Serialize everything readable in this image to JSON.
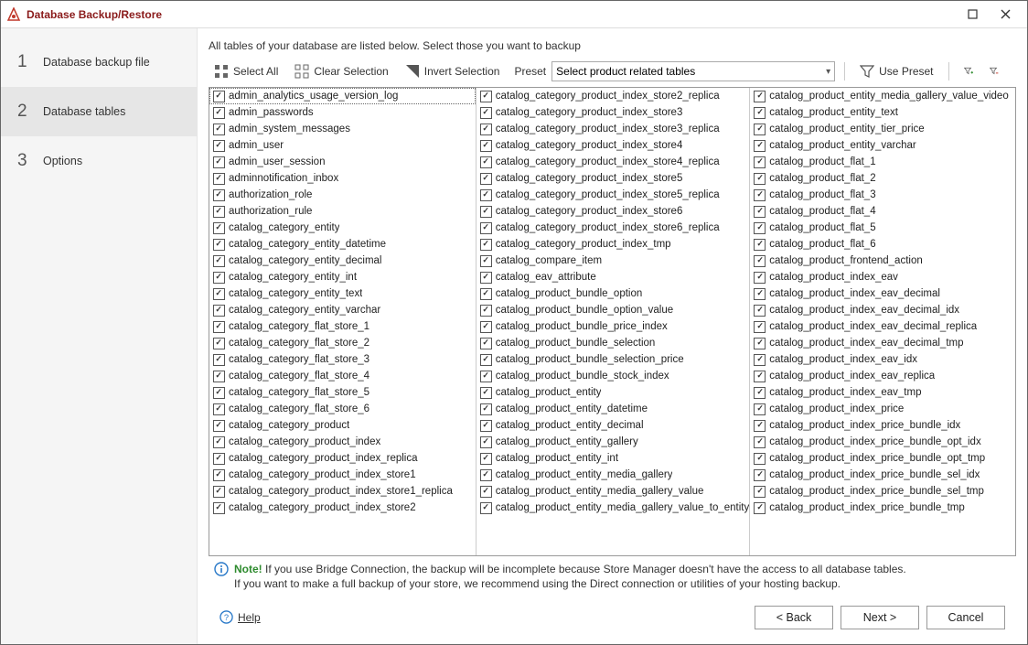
{
  "window": {
    "title": "Database Backup/Restore",
    "maximize_icon": "maximize-icon",
    "close_icon": "close-icon"
  },
  "sidebar": {
    "steps": [
      {
        "num": "1",
        "label": "Database backup file"
      },
      {
        "num": "2",
        "label": "Database tables"
      },
      {
        "num": "3",
        "label": "Options"
      }
    ],
    "active_index": 1
  },
  "main": {
    "instructions": "All tables of your database are listed below. Select those you want to backup",
    "toolbar": {
      "select_all": "Select All",
      "clear_selection": "Clear Selection",
      "invert_selection": "Invert Selection",
      "preset_label": "Preset",
      "preset_value": "Select product related tables",
      "use_preset": "Use Preset"
    },
    "tables": {
      "col1": [
        "admin_analytics_usage_version_log",
        "admin_passwords",
        "admin_system_messages",
        "admin_user",
        "admin_user_session",
        "adminnotification_inbox",
        "authorization_role",
        "authorization_rule",
        "catalog_category_entity",
        "catalog_category_entity_datetime",
        "catalog_category_entity_decimal",
        "catalog_category_entity_int",
        "catalog_category_entity_text",
        "catalog_category_entity_varchar",
        "catalog_category_flat_store_1",
        "catalog_category_flat_store_2",
        "catalog_category_flat_store_3",
        "catalog_category_flat_store_4",
        "catalog_category_flat_store_5",
        "catalog_category_flat_store_6",
        "catalog_category_product",
        "catalog_category_product_index",
        "catalog_category_product_index_replica",
        "catalog_category_product_index_store1",
        "catalog_category_product_index_store1_replica",
        "catalog_category_product_index_store2"
      ],
      "col2": [
        "catalog_category_product_index_store2_replica",
        "catalog_category_product_index_store3",
        "catalog_category_product_index_store3_replica",
        "catalog_category_product_index_store4",
        "catalog_category_product_index_store4_replica",
        "catalog_category_product_index_store5",
        "catalog_category_product_index_store5_replica",
        "catalog_category_product_index_store6",
        "catalog_category_product_index_store6_replica",
        "catalog_category_product_index_tmp",
        "catalog_compare_item",
        "catalog_eav_attribute",
        "catalog_product_bundle_option",
        "catalog_product_bundle_option_value",
        "catalog_product_bundle_price_index",
        "catalog_product_bundle_selection",
        "catalog_product_bundle_selection_price",
        "catalog_product_bundle_stock_index",
        "catalog_product_entity",
        "catalog_product_entity_datetime",
        "catalog_product_entity_decimal",
        "catalog_product_entity_gallery",
        "catalog_product_entity_int",
        "catalog_product_entity_media_gallery",
        "catalog_product_entity_media_gallery_value",
        "catalog_product_entity_media_gallery_value_to_entity"
      ],
      "col3": [
        "catalog_product_entity_media_gallery_value_video",
        "catalog_product_entity_text",
        "catalog_product_entity_tier_price",
        "catalog_product_entity_varchar",
        "catalog_product_flat_1",
        "catalog_product_flat_2",
        "catalog_product_flat_3",
        "catalog_product_flat_4",
        "catalog_product_flat_5",
        "catalog_product_flat_6",
        "catalog_product_frontend_action",
        "catalog_product_index_eav",
        "catalog_product_index_eav_decimal",
        "catalog_product_index_eav_decimal_idx",
        "catalog_product_index_eav_decimal_replica",
        "catalog_product_index_eav_decimal_tmp",
        "catalog_product_index_eav_idx",
        "catalog_product_index_eav_replica",
        "catalog_product_index_eav_tmp",
        "catalog_product_index_price",
        "catalog_product_index_price_bundle_idx",
        "catalog_product_index_price_bundle_opt_idx",
        "catalog_product_index_price_bundle_opt_tmp",
        "catalog_product_index_price_bundle_sel_idx",
        "catalog_product_index_price_bundle_sel_tmp",
        "catalog_product_index_price_bundle_tmp"
      ]
    },
    "note": {
      "prefix": "Note!",
      "line1": " If you use Bridge Connection, the backup will be incomplete because Store Manager doesn't have the access to all database tables.",
      "line2": "If you want to make a full backup of your store, we recommend using the Direct connection or utilities of your hosting backup."
    }
  },
  "footer": {
    "help": "Help",
    "back": "< Back",
    "next": "Next >",
    "cancel": "Cancel"
  }
}
